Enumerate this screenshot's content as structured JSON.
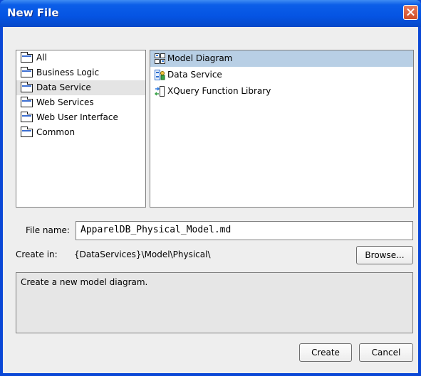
{
  "window": {
    "title": "New File"
  },
  "categories": [
    {
      "label": "All",
      "selected": false
    },
    {
      "label": "Business Logic",
      "selected": false
    },
    {
      "label": "Data Service",
      "selected": true
    },
    {
      "label": "Web Services",
      "selected": false
    },
    {
      "label": "Web User Interface",
      "selected": false
    },
    {
      "label": "Common",
      "selected": false
    }
  ],
  "templates": [
    {
      "label": "Model Diagram",
      "icon": "model-diagram-icon",
      "selected": true
    },
    {
      "label": "Data Service",
      "icon": "data-service-icon",
      "selected": false
    },
    {
      "label": "XQuery Function Library",
      "icon": "xquery-library-icon",
      "selected": false
    }
  ],
  "filename": {
    "label": "File name:",
    "value": "ApparelDB_Physical_Model.md"
  },
  "create_in": {
    "label": "Create in:",
    "value": "{DataServices}\\Model\\Physical\\"
  },
  "buttons": {
    "browse": "Browse...",
    "create": "Create",
    "cancel": "Cancel"
  },
  "description": "Create a new model diagram.",
  "colors": {
    "title_bar": "#0554e3",
    "selection": "#b8cfe5",
    "close": "#d24d25"
  }
}
